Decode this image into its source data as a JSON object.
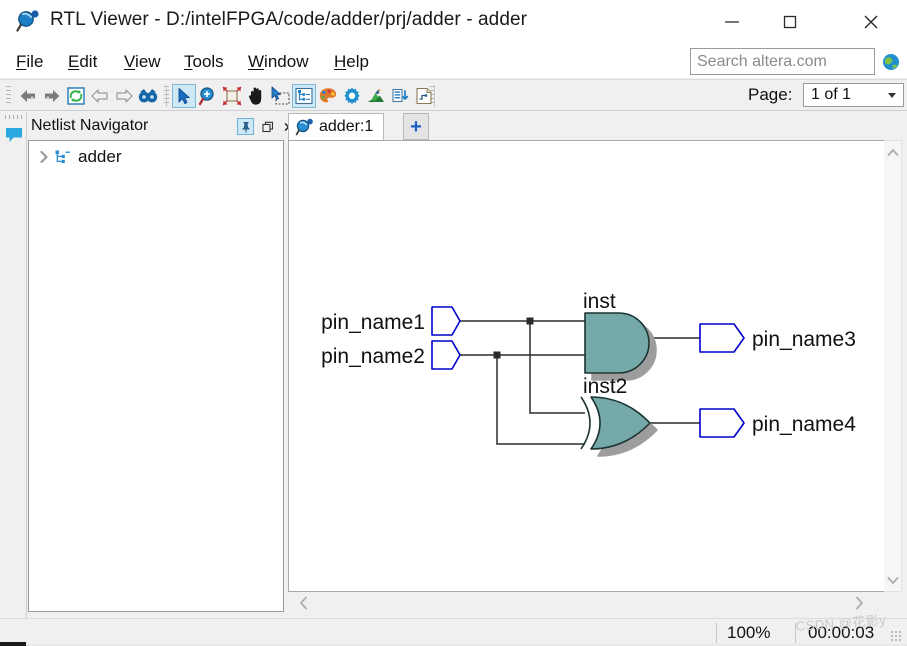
{
  "window": {
    "title": "RTL Viewer - D:/intelFPGA/code/adder/prj/adder - adder",
    "app_icon": "rtl-viewer-icon",
    "minimize_label": "Minimize",
    "maximize_label": "Maximize",
    "close_label": "Close"
  },
  "menubar": {
    "items": [
      {
        "label": "File",
        "mnemonic": "F"
      },
      {
        "label": "Edit",
        "mnemonic": "E"
      },
      {
        "label": "View",
        "mnemonic": "V"
      },
      {
        "label": "Tools",
        "mnemonic": "T"
      },
      {
        "label": "Window",
        "mnemonic": "W"
      },
      {
        "label": "Help",
        "mnemonic": "H"
      }
    ]
  },
  "search": {
    "placeholder": "Search altera.com",
    "value": "",
    "globe_icon": "globe-icon"
  },
  "toolbar": {
    "nav_buttons": [
      {
        "name": "back-icon",
        "label": "Back"
      },
      {
        "name": "forward-icon",
        "label": "Forward"
      },
      {
        "name": "refresh-icon",
        "label": "Refresh"
      },
      {
        "name": "go-up-icon",
        "label": "Go Up"
      },
      {
        "name": "go-down-icon",
        "label": "Go Down"
      },
      {
        "name": "find-icon",
        "label": "Find"
      }
    ],
    "tool_buttons": [
      {
        "name": "select-arrow-icon",
        "label": "Selection Tool",
        "selected": true
      },
      {
        "name": "zoom-icon",
        "label": "Zoom Tool",
        "selected": false
      },
      {
        "name": "fit-in-window-icon",
        "label": "Fit in Window",
        "selected": false
      },
      {
        "name": "hand-pan-icon",
        "label": "Hand Tool",
        "selected": false
      },
      {
        "name": "rubber-band-select-icon",
        "label": "Area Select",
        "selected": false
      },
      {
        "name": "netlist-navigator-icon",
        "label": "Netlist Navigator",
        "selected": true
      },
      {
        "name": "color-palette-icon",
        "label": "Color Settings",
        "selected": false
      },
      {
        "name": "gear-settings-icon",
        "label": "Options",
        "selected": false
      },
      {
        "name": "probe-icon",
        "label": "Probe",
        "selected": false
      },
      {
        "name": "hierarchy-down-icon",
        "label": "Enter Hierarchy",
        "selected": false
      },
      {
        "name": "export-schematic-icon",
        "label": "Export",
        "selected": false
      }
    ],
    "page_label": "Page:",
    "page_value": "1 of 1"
  },
  "left_strip": {
    "bubble_icon": "message-bubble-icon"
  },
  "navigator": {
    "title": "Netlist Navigator",
    "pin_button": "pin-icon",
    "float_button": "restore-icon",
    "close_button": "close-icon",
    "tree": [
      {
        "label": "adder",
        "icon": "module-icon",
        "expanded": false
      }
    ]
  },
  "tabs": {
    "items": [
      {
        "label": "adder:1",
        "icon": "rtl-viewer-icon",
        "active": true
      }
    ],
    "add_label": "+"
  },
  "schematic": {
    "input_pins": [
      {
        "label": "pin_name1"
      },
      {
        "label": "pin_name2"
      }
    ],
    "output_pins": [
      {
        "label": "pin_name3"
      },
      {
        "label": "pin_name4"
      }
    ],
    "gates": [
      {
        "label": "inst",
        "type": "AND"
      },
      {
        "label": "inst2",
        "type": "XOR"
      }
    ],
    "colors": {
      "gate_fill": "#74a8a8",
      "gate_stroke": "#1c3333",
      "gate_shadow": "#9d9d9d",
      "pin_stroke": "#0000cc",
      "wire": "#2b2b2b"
    }
  },
  "scrollbars": {
    "v_up": "chevron-up-icon",
    "v_down": "chevron-down-icon",
    "h_left": "chevron-left-icon",
    "h_right": "chevron-right-icon"
  },
  "statusbar": {
    "zoom": "100%",
    "elapsed_time": "00:00:03",
    "watermark": "CSDN @花影y"
  }
}
